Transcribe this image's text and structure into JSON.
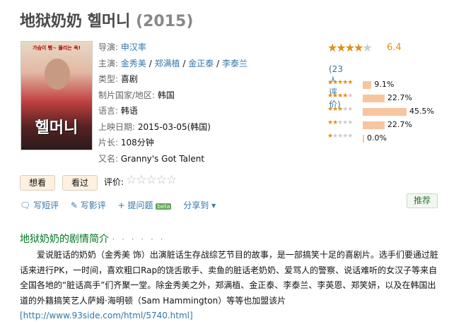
{
  "title": {
    "name": "地狱奶奶 헬머니",
    "year": "(2015)"
  },
  "poster": {
    "tagline": "가슴이 뻥~ 뚫리는 욕!",
    "title_text": "헬머니"
  },
  "info": {
    "director_label": "导演:",
    "director": "申汉率",
    "cast_label": "主演:",
    "cast": [
      "金秀美",
      "郑满植",
      "金正泰",
      "李泰兰"
    ],
    "genre_label": "类型:",
    "genre": "喜剧",
    "country_label": "制片国家/地区:",
    "country": "韩国",
    "language_label": "语言:",
    "language": "韩语",
    "release_label": "上映日期:",
    "release": "2015-03-05(韩国)",
    "runtime_label": "片长:",
    "runtime": "108分钟",
    "aka_label": "又名:",
    "aka": "Granny's Got Talent"
  },
  "rating": {
    "score": "6.4",
    "stars_filled": 3.5,
    "votes": "(23人评价)",
    "breakdown": [
      {
        "stars": 5,
        "percent": 9.1,
        "label": "9.1%"
      },
      {
        "stars": 4,
        "percent": 22.7,
        "label": "22.7%"
      },
      {
        "stars": 3,
        "percent": 45.5,
        "label": "45.5%"
      },
      {
        "stars": 2,
        "percent": 22.7,
        "label": "22.7%"
      },
      {
        "stars": 1,
        "percent": 0.0,
        "label": "0.0%"
      }
    ]
  },
  "buttons": {
    "want": "想看",
    "seen": "看过",
    "rate_label": "评价:"
  },
  "actions": {
    "short_review": "写短评",
    "review": "写影评",
    "ask": "+ 提问题",
    "beta": "beta",
    "share": "分享到",
    "recommend": "推荐"
  },
  "summary": {
    "heading": "地狱奶奶的剧情简介",
    "dots": "· · · · · ·",
    "text": "爱说脏话的奶奶（金秀美 饰）出演脏话生存战综艺节目的故事，是一部搞笑十足的喜剧片。选手们要通过脏话来进行PK，一时间，喜欢粗口Rap的饶舌歌手、卖鱼的脏话老奶奶、爱骂人的警察、说话难听的女汉子等来自全国各地的“脏话高手”们齐聚一堂。除金秀美之外，郑满植、金正泰、李泰兰、李英恩、郑笑妍，以及在韩国出道的外籍搞笑艺人萨姆·海明顿（Sam Hammington）等等也加盟该片",
    "link": "[http://www.93side.com/html/5740.html]"
  },
  "colors": {
    "star": "#e09015",
    "link": "#3377aa",
    "section_title": "#007722",
    "bar": "#f7c5a0"
  }
}
